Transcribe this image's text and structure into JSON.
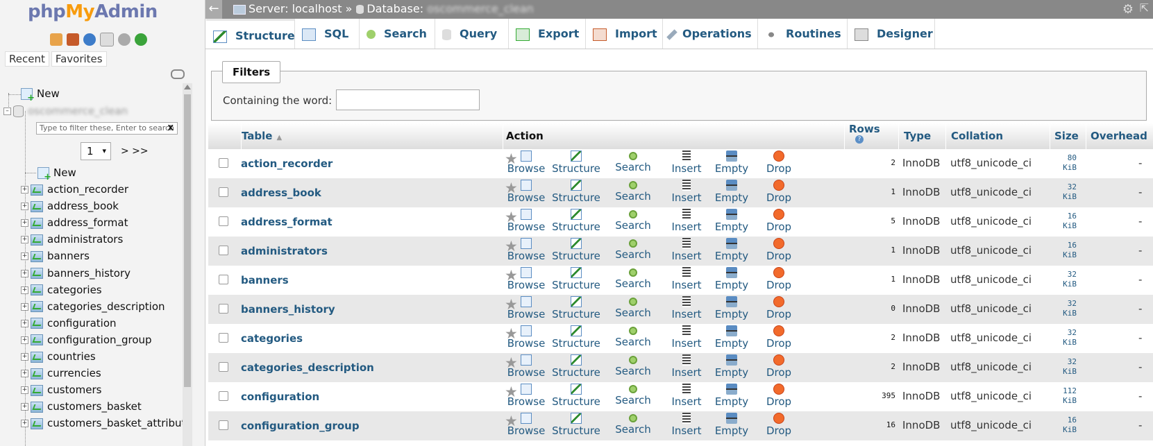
{
  "app": {
    "logo_php": "php",
    "logo_my": "My",
    "logo_admin": "Admin"
  },
  "left": {
    "recent": "Recent",
    "favorites": "Favorites",
    "new_root": "New",
    "db_name": "oscommerce_clean",
    "filter_placeholder": "Type to filter these, Enter to search",
    "filter_clear": "X",
    "page_select": "1",
    "page_next": "> >>",
    "new_table": "New",
    "tables": [
      "action_recorder",
      "address_book",
      "address_format",
      "administrators",
      "banners",
      "banners_history",
      "categories",
      "categories_description",
      "configuration",
      "configuration_group",
      "countries",
      "currencies",
      "customers",
      "customers_basket",
      "customers_basket_attribute"
    ]
  },
  "topbar": {
    "server_label": "Server: localhost »",
    "db_label": "Database:",
    "db_name": "oscommerce_clean",
    "back": "←",
    "collapse": "⇱"
  },
  "tabs": [
    "Structure",
    "SQL",
    "Search",
    "Query",
    "Export",
    "Import",
    "Operations",
    "Routines",
    "Designer"
  ],
  "filters": {
    "legend": "Filters",
    "containing": "Containing the word:"
  },
  "table_head": {
    "table": "Table",
    "action": "Action",
    "rows": "Rows",
    "type": "Type",
    "collation": "Collation",
    "size": "Size",
    "overhead": "Overhead",
    "rows_help": "?"
  },
  "actions": [
    "Browse",
    "Structure",
    "Search",
    "Insert",
    "Empty",
    "Drop"
  ],
  "rows": [
    {
      "name": "action_recorder",
      "rows": "2",
      "type": "InnoDB",
      "collation": "utf8_unicode_ci",
      "size": "80",
      "unit": "KiB",
      "overhead": "-"
    },
    {
      "name": "address_book",
      "rows": "1",
      "type": "InnoDB",
      "collation": "utf8_unicode_ci",
      "size": "32",
      "unit": "KiB",
      "overhead": "-"
    },
    {
      "name": "address_format",
      "rows": "5",
      "type": "InnoDB",
      "collation": "utf8_unicode_ci",
      "size": "16",
      "unit": "KiB",
      "overhead": "-"
    },
    {
      "name": "administrators",
      "rows": "1",
      "type": "InnoDB",
      "collation": "utf8_unicode_ci",
      "size": "16",
      "unit": "KiB",
      "overhead": "-"
    },
    {
      "name": "banners",
      "rows": "1",
      "type": "InnoDB",
      "collation": "utf8_unicode_ci",
      "size": "32",
      "unit": "KiB",
      "overhead": "-"
    },
    {
      "name": "banners_history",
      "rows": "0",
      "type": "InnoDB",
      "collation": "utf8_unicode_ci",
      "size": "32",
      "unit": "KiB",
      "overhead": "-"
    },
    {
      "name": "categories",
      "rows": "2",
      "type": "InnoDB",
      "collation": "utf8_unicode_ci",
      "size": "32",
      "unit": "KiB",
      "overhead": "-"
    },
    {
      "name": "categories_description",
      "rows": "2",
      "type": "InnoDB",
      "collation": "utf8_unicode_ci",
      "size": "32",
      "unit": "KiB",
      "overhead": "-"
    },
    {
      "name": "configuration",
      "rows": "395",
      "type": "InnoDB",
      "collation": "utf8_unicode_ci",
      "size": "112",
      "unit": "KiB",
      "overhead": "-"
    },
    {
      "name": "configuration_group",
      "rows": "16",
      "type": "InnoDB",
      "collation": "utf8_unicode_ci",
      "size": "16",
      "unit": "KiB",
      "overhead": "-"
    }
  ]
}
